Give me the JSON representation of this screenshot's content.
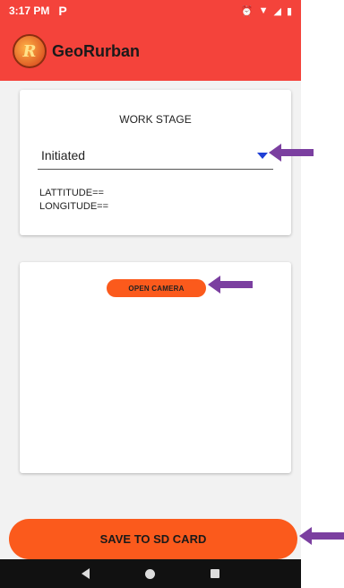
{
  "status_bar": {
    "time": "3:17 PM",
    "notification_icon": "P",
    "icons": [
      "alarm-icon",
      "wifi-icon",
      "signal-icon",
      "battery-icon"
    ]
  },
  "app_bar": {
    "logo_text": "R",
    "title": "GeoRurban"
  },
  "work_stage": {
    "label": "WORK STAGE",
    "selected": "Initiated",
    "latitude_label": "LATTITUDE==",
    "longitude_label": "LONGITUDE=="
  },
  "camera": {
    "button_label": "OPEN CAMERA"
  },
  "footer": {
    "save_label": "SAVE TO SD CARD"
  },
  "colors": {
    "appbar": "#f4433b",
    "accent_button": "#fb5a1c",
    "annotation_arrow": "#7b3fa0",
    "spinner_arrow": "#1f3fd6"
  }
}
